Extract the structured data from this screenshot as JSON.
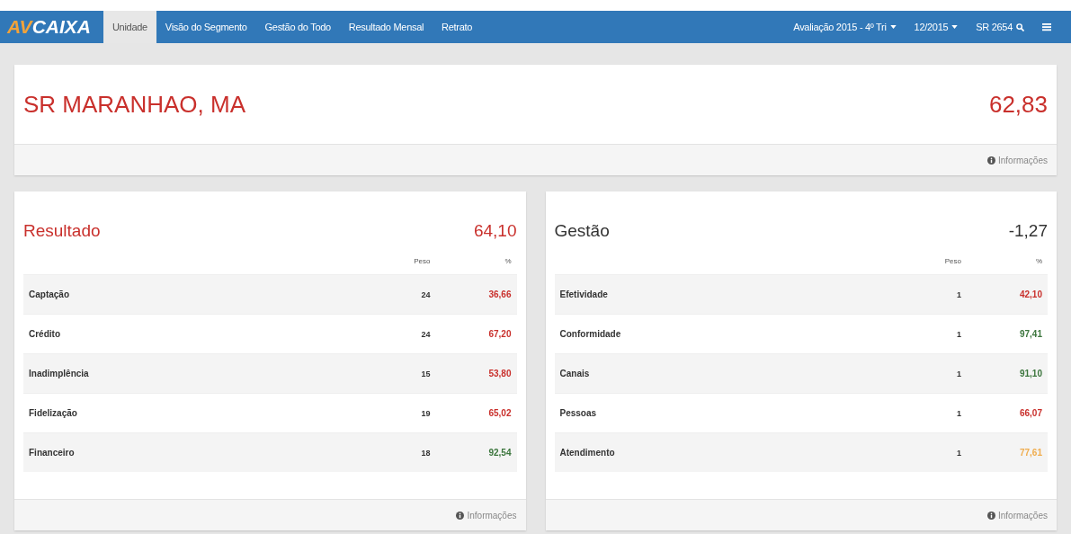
{
  "navbar": {
    "logo": {
      "prefix": "AV",
      "name": "CAIXA"
    },
    "tabs": [
      {
        "label": "Unidade",
        "selected": true
      },
      {
        "label": "Visão do Segmento",
        "selected": false
      },
      {
        "label": "Gestão do Todo",
        "selected": false
      },
      {
        "label": "Resultado Mensal",
        "selected": false
      },
      {
        "label": "Retrato",
        "selected": false
      }
    ],
    "right": [
      {
        "kind": "dropdown",
        "label": "Avaliação 2015 - 4º Tri"
      },
      {
        "kind": "dropdown",
        "label": "12/2015"
      },
      {
        "kind": "search",
        "label": "SR 2654"
      },
      {
        "kind": "menu"
      }
    ]
  },
  "summary": {
    "title": "SR MARANHAO, MA",
    "score": "62,83",
    "info": "Informações"
  },
  "panels": [
    {
      "title": "Resultado",
      "score": "64,10",
      "color": "#c9302c",
      "columns": [
        "Peso",
        "%"
      ],
      "rows": [
        {
          "name": "Captação",
          "weight": "24",
          "value": "36,66",
          "color": "#c9302c"
        },
        {
          "name": "Crédito",
          "weight": "24",
          "value": "67,20",
          "color": "#c9302c"
        },
        {
          "name": "Inadimplência",
          "weight": "15",
          "value": "53,80",
          "color": "#c9302c"
        },
        {
          "name": "Fidelização",
          "weight": "19",
          "value": "65,02",
          "color": "#c9302c"
        },
        {
          "name": "Financeiro",
          "weight": "18",
          "value": "92,54",
          "color": "#3c763d"
        }
      ],
      "info": "Informações"
    },
    {
      "title": "Gestão",
      "score": "-1,27",
      "color": "#333333",
      "columns": [
        "Peso",
        "%"
      ],
      "rows": [
        {
          "name": "Efetividade",
          "weight": "1",
          "value": "42,10",
          "color": "#c9302c"
        },
        {
          "name": "Conformidade",
          "weight": "1",
          "value": "97,41",
          "color": "#3c763d"
        },
        {
          "name": "Canais",
          "weight": "1",
          "value": "91,10",
          "color": "#3c763d"
        },
        {
          "name": "Pessoas",
          "weight": "1",
          "value": "66,07",
          "color": "#c9302c"
        },
        {
          "name": "Atendimento",
          "weight": "1",
          "value": "77,61",
          "color": "#f0ad4e"
        }
      ],
      "info": "Informações"
    }
  ]
}
